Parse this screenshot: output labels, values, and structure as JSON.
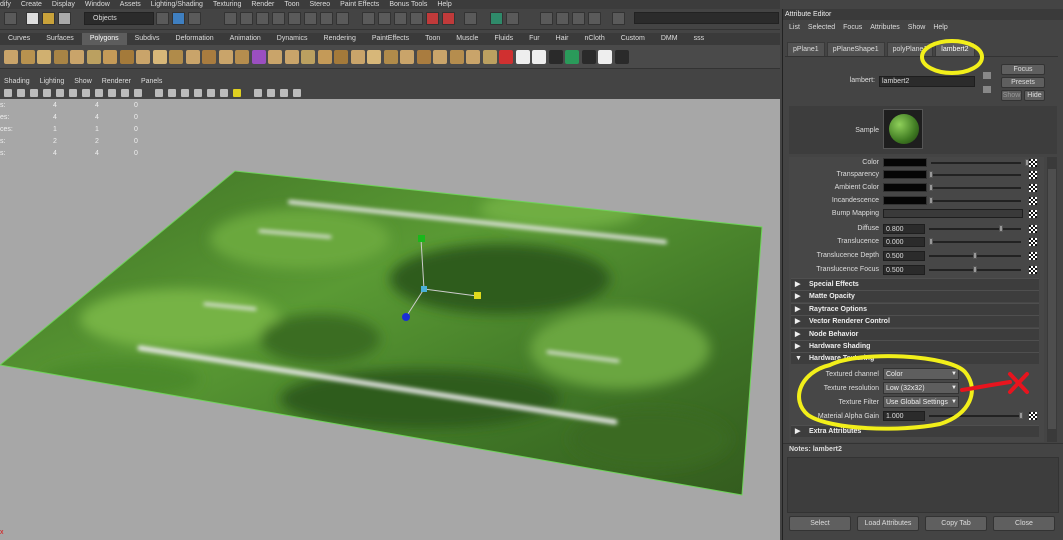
{
  "menu": [
    "dify",
    "Create",
    "Display",
    "Window",
    "Assets",
    "Lighting/Shading",
    "Texturing",
    "Render",
    "Toon",
    "Stereo",
    "Paint Effects",
    "Bonus Tools",
    "Help"
  ],
  "statusline": {
    "objects_label": "Objects"
  },
  "shelf_tabs": [
    "Curves",
    "Surfaces",
    "Polygons",
    "Subdivs",
    "Deformation",
    "Animation",
    "Dynamics",
    "Rendering",
    "PaintEffects",
    "Toon",
    "Muscle",
    "Fluids",
    "Fur",
    "Hair",
    "nCloth",
    "Custom",
    "DMM",
    "sss"
  ],
  "shelf_active": "Polygons",
  "panel_menu": [
    "Shading",
    "Lighting",
    "Show",
    "Renderer",
    "Panels"
  ],
  "hud": [
    {
      "label": "s:",
      "a": "4",
      "b": "4",
      "c": "0"
    },
    {
      "label": "es:",
      "a": "4",
      "b": "4",
      "c": "0"
    },
    {
      "label": "ces:",
      "a": "1",
      "b": "1",
      "c": "0"
    },
    {
      "label": "s:",
      "a": "2",
      "b": "2",
      "c": "0"
    },
    {
      "label": "s:",
      "a": "4",
      "b": "4",
      "c": "0"
    }
  ],
  "axis_x_label": "x",
  "attribute_editor": {
    "title": "Attribute Editor",
    "menu": [
      "List",
      "Selected",
      "Focus",
      "Attributes",
      "Show",
      "Help"
    ],
    "tabs": [
      "pPlane1",
      "pPlaneShape1",
      "polyPlane1",
      "lambert2"
    ],
    "active_tab": "lambert2",
    "node_type_label": "lambert:",
    "node_name": "lambert2",
    "buttons": {
      "focus": "Focus",
      "presets": "Presets",
      "show": "Show",
      "hide": "Hide"
    },
    "sample_label": "Sample",
    "attributes": [
      {
        "label": "Color",
        "value": ""
      },
      {
        "label": "Transparency",
        "value": ""
      },
      {
        "label": "Ambient Color",
        "value": ""
      },
      {
        "label": "Incandescence",
        "value": ""
      },
      {
        "label": "Bump Mapping",
        "value": ""
      },
      {
        "label": "Diffuse",
        "value": "0.800"
      },
      {
        "label": "Translucence",
        "value": "0.000"
      },
      {
        "label": "Translucence Depth",
        "value": "0.500"
      },
      {
        "label": "Translucence Focus",
        "value": "0.500"
      }
    ],
    "sections_collapsed": [
      "Special Effects",
      "Matte Opacity",
      "Raytrace Options",
      "Vector Renderer Control",
      "Node Behavior",
      "Hardware Shading"
    ],
    "section_expanded": "Hardware Texturing",
    "hw_texturing": {
      "textured_channel_label": "Textured channel",
      "textured_channel_value": "Color",
      "texture_resolution_label": "Texture resolution",
      "texture_resolution_value": "Low (32x32)",
      "texture_filter_label": "Texture Filter",
      "texture_filter_value": "Use Global Settings",
      "gain_label": "Material Alpha Gain",
      "gain_value": "1.000"
    },
    "extra_section": "Extra Attributes",
    "notes_label": "Notes:  lambert2",
    "bottom_buttons": [
      "Select",
      "Load Attributes",
      "Copy Tab",
      "Close"
    ]
  },
  "colors": {
    "annotation": "#f2ef1a",
    "annotation_x": "#e8141e",
    "grass": "#4d8a2b",
    "viewport_bg": "#a7a7a7"
  }
}
